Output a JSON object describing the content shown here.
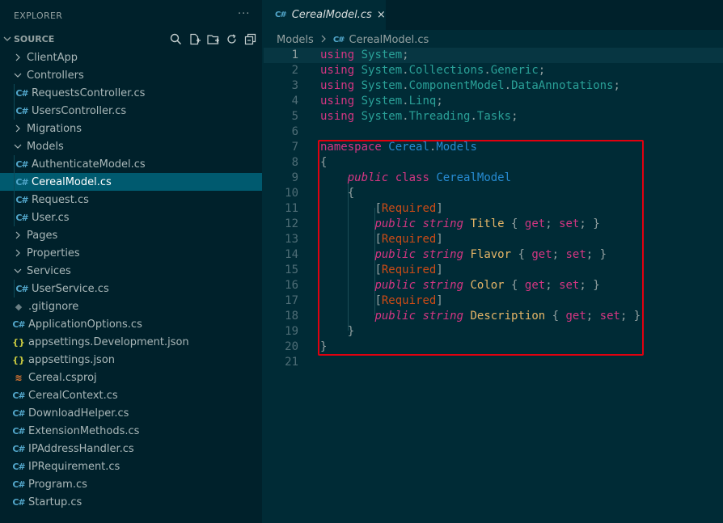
{
  "explorer": {
    "title": "EXPLORER",
    "more": "···",
    "section_label": "SOURCE"
  },
  "tree": [
    {
      "name": "ClientApp",
      "kind": "folder",
      "expanded": false,
      "depth": 0
    },
    {
      "name": "Controllers",
      "kind": "folder",
      "expanded": true,
      "depth": 0
    },
    {
      "name": "RequestsController.cs",
      "kind": "cs",
      "depth": 1
    },
    {
      "name": "UsersController.cs",
      "kind": "cs",
      "depth": 1
    },
    {
      "name": "Migrations",
      "kind": "folder",
      "expanded": false,
      "depth": 0
    },
    {
      "name": "Models",
      "kind": "folder",
      "expanded": true,
      "depth": 0
    },
    {
      "name": "AuthenticateModel.cs",
      "kind": "cs",
      "depth": 1
    },
    {
      "name": "CerealModel.cs",
      "kind": "cs",
      "depth": 1,
      "selected": true
    },
    {
      "name": "Request.cs",
      "kind": "cs",
      "depth": 1
    },
    {
      "name": "User.cs",
      "kind": "cs",
      "depth": 1
    },
    {
      "name": "Pages",
      "kind": "folder",
      "expanded": false,
      "depth": 0
    },
    {
      "name": "Properties",
      "kind": "folder",
      "expanded": false,
      "depth": 0
    },
    {
      "name": "Services",
      "kind": "folder",
      "expanded": true,
      "depth": 0
    },
    {
      "name": "UserService.cs",
      "kind": "cs",
      "depth": 1
    },
    {
      "name": ".gitignore",
      "kind": "git",
      "depth": 0
    },
    {
      "name": "ApplicationOptions.cs",
      "kind": "cs",
      "depth": 0
    },
    {
      "name": "appsettings.Development.json",
      "kind": "json",
      "depth": 0
    },
    {
      "name": "appsettings.json",
      "kind": "json",
      "depth": 0
    },
    {
      "name": "Cereal.csproj",
      "kind": "rss",
      "depth": 0
    },
    {
      "name": "CerealContext.cs",
      "kind": "cs",
      "depth": 0
    },
    {
      "name": "DownloadHelper.cs",
      "kind": "cs",
      "depth": 0
    },
    {
      "name": "ExtensionMethods.cs",
      "kind": "cs",
      "depth": 0
    },
    {
      "name": "IPAddressHandler.cs",
      "kind": "cs",
      "depth": 0
    },
    {
      "name": "IPRequirement.cs",
      "kind": "cs",
      "depth": 0
    },
    {
      "name": "Program.cs",
      "kind": "cs",
      "depth": 0
    },
    {
      "name": "Startup.cs",
      "kind": "cs",
      "depth": 0
    }
  ],
  "tab": {
    "label": "CerealModel.cs",
    "close": "×"
  },
  "breadcrumb": {
    "folder": "Models",
    "file": "CerealModel.cs"
  },
  "icons": {
    "cs": "C#",
    "json": "{}",
    "git": "◆",
    "rss": "≋"
  },
  "colors": {
    "sidebar_bg": "#00212b",
    "editor_bg": "#002b36",
    "selection": "#005a6f",
    "highlight_box": "#e0000f"
  },
  "code": [
    [
      [
        "kw",
        "using"
      ],
      [
        "t",
        " "
      ],
      [
        "ns",
        "System"
      ],
      [
        "t",
        ";"
      ]
    ],
    [
      [
        "kw",
        "using"
      ],
      [
        "t",
        " "
      ],
      [
        "ns",
        "System"
      ],
      [
        "t",
        "."
      ],
      [
        "ns",
        "Collections"
      ],
      [
        "t",
        "."
      ],
      [
        "ns",
        "Generic"
      ],
      [
        "t",
        ";"
      ]
    ],
    [
      [
        "kw",
        "using"
      ],
      [
        "t",
        " "
      ],
      [
        "ns",
        "System"
      ],
      [
        "t",
        "."
      ],
      [
        "ns",
        "ComponentModel"
      ],
      [
        "t",
        "."
      ],
      [
        "ns",
        "DataAnnotations"
      ],
      [
        "t",
        ";"
      ]
    ],
    [
      [
        "kw",
        "using"
      ],
      [
        "t",
        " "
      ],
      [
        "ns",
        "System"
      ],
      [
        "t",
        "."
      ],
      [
        "ns",
        "Linq"
      ],
      [
        "t",
        ";"
      ]
    ],
    [
      [
        "kw",
        "using"
      ],
      [
        "t",
        " "
      ],
      [
        "ns",
        "System"
      ],
      [
        "t",
        "."
      ],
      [
        "ns",
        "Threading"
      ],
      [
        "t",
        "."
      ],
      [
        "ns",
        "Tasks"
      ],
      [
        "t",
        ";"
      ]
    ],
    [],
    [
      [
        "kw",
        "namespace"
      ],
      [
        "t",
        " "
      ],
      [
        "ty",
        "Cereal"
      ],
      [
        "t",
        "."
      ],
      [
        "ty",
        "Models"
      ]
    ],
    [
      [
        "t",
        "{"
      ]
    ],
    [
      [
        "t",
        "    "
      ],
      [
        "kw-i",
        "public"
      ],
      [
        "t",
        " "
      ],
      [
        "kw",
        "class"
      ],
      [
        "t",
        " "
      ],
      [
        "ty",
        "CerealModel"
      ]
    ],
    [
      [
        "t",
        "    {"
      ]
    ],
    [
      [
        "t",
        "        "
      ],
      [
        "t",
        "["
      ],
      [
        "attr",
        "Required"
      ],
      [
        "t",
        "]"
      ]
    ],
    [
      [
        "t",
        "        "
      ],
      [
        "kw-i",
        "public"
      ],
      [
        "t",
        " "
      ],
      [
        "kw-i",
        "string"
      ],
      [
        "t",
        " "
      ],
      [
        "prop",
        "Title"
      ],
      [
        "t",
        " { "
      ],
      [
        "acc",
        "get"
      ],
      [
        "t",
        "; "
      ],
      [
        "acc",
        "set"
      ],
      [
        "t",
        "; }"
      ]
    ],
    [
      [
        "t",
        "        "
      ],
      [
        "t",
        "["
      ],
      [
        "attr",
        "Required"
      ],
      [
        "t",
        "]"
      ]
    ],
    [
      [
        "t",
        "        "
      ],
      [
        "kw-i",
        "public"
      ],
      [
        "t",
        " "
      ],
      [
        "kw-i",
        "string"
      ],
      [
        "t",
        " "
      ],
      [
        "prop",
        "Flavor"
      ],
      [
        "t",
        " { "
      ],
      [
        "acc",
        "get"
      ],
      [
        "t",
        "; "
      ],
      [
        "acc",
        "set"
      ],
      [
        "t",
        "; }"
      ]
    ],
    [
      [
        "t",
        "        "
      ],
      [
        "t",
        "["
      ],
      [
        "attr",
        "Required"
      ],
      [
        "t",
        "]"
      ]
    ],
    [
      [
        "t",
        "        "
      ],
      [
        "kw-i",
        "public"
      ],
      [
        "t",
        " "
      ],
      [
        "kw-i",
        "string"
      ],
      [
        "t",
        " "
      ],
      [
        "prop",
        "Color"
      ],
      [
        "t",
        " { "
      ],
      [
        "acc",
        "get"
      ],
      [
        "t",
        "; "
      ],
      [
        "acc",
        "set"
      ],
      [
        "t",
        "; }"
      ]
    ],
    [
      [
        "t",
        "        "
      ],
      [
        "t",
        "["
      ],
      [
        "attr",
        "Required"
      ],
      [
        "t",
        "]"
      ]
    ],
    [
      [
        "t",
        "        "
      ],
      [
        "kw-i",
        "public"
      ],
      [
        "t",
        " "
      ],
      [
        "kw-i",
        "string"
      ],
      [
        "t",
        " "
      ],
      [
        "prop",
        "Description"
      ],
      [
        "t",
        " { "
      ],
      [
        "acc",
        "get"
      ],
      [
        "t",
        "; "
      ],
      [
        "acc",
        "set"
      ],
      [
        "t",
        "; }"
      ]
    ],
    [
      [
        "t",
        "    }"
      ]
    ],
    [
      [
        "t",
        "}"
      ]
    ],
    []
  ],
  "current_line": 1
}
